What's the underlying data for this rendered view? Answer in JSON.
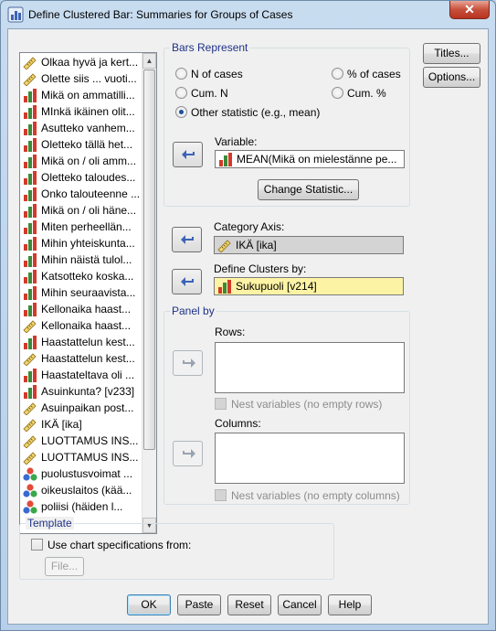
{
  "window": {
    "title": "Define Clustered Bar: Summaries for Groups of Cases",
    "close_glyph": "✕"
  },
  "variables": [
    {
      "label": "Olkaa hyvä ja kert...",
      "icon": "scale-ruler-icon"
    },
    {
      "label": "Olette siis ... vuoti...",
      "icon": "scale-ruler-icon"
    },
    {
      "label": "Mikä on ammatilli...",
      "icon": "bar-chart-icon"
    },
    {
      "label": "MInkä ikäinen olit...",
      "icon": "bar-chart-icon"
    },
    {
      "label": "Asutteko vanhem...",
      "icon": "bar-chart-icon"
    },
    {
      "label": "Oletteko tällä het...",
      "icon": "bar-chart-icon"
    },
    {
      "label": "Mikä on / oli amm...",
      "icon": "bar-chart-icon"
    },
    {
      "label": "Oletteko taloudes...",
      "icon": "bar-chart-icon"
    },
    {
      "label": "Onko talouteenne ...",
      "icon": "bar-chart-icon"
    },
    {
      "label": "Mikä on / oli häne...",
      "icon": "bar-chart-icon"
    },
    {
      "label": "Miten perheellän...",
      "icon": "bar-chart-icon"
    },
    {
      "label": "Mihin yhteiskunta...",
      "icon": "bar-chart-icon"
    },
    {
      "label": "Mihin näistä tulol...",
      "icon": "bar-chart-icon"
    },
    {
      "label": "Katsotteko koska...",
      "icon": "bar-chart-icon"
    },
    {
      "label": "Mihin seuraavista...",
      "icon": "bar-chart-icon"
    },
    {
      "label": "Kellonaika haast...",
      "icon": "bar-chart-icon"
    },
    {
      "label": "Kellonaika haast...",
      "icon": "scale-ruler-icon"
    },
    {
      "label": "Haastattelun kest...",
      "icon": "bar-chart-icon"
    },
    {
      "label": "Haastattelun kest...",
      "icon": "scale-ruler-icon"
    },
    {
      "label": "Haastateltava oli ...",
      "icon": "bar-chart-icon"
    },
    {
      "label": "Asuinkunta? [v233]",
      "icon": "bar-chart-icon"
    },
    {
      "label": "Asuinpaikan post...",
      "icon": "scale-ruler-icon"
    },
    {
      "label": "IKÄ [ika]",
      "icon": "scale-ruler-icon"
    },
    {
      "label": "LUOTTAMUS INS...",
      "icon": "scale-ruler-icon"
    },
    {
      "label": "LUOTTAMUS INS...",
      "icon": "scale-ruler-icon"
    },
    {
      "label": "puolustusvoimat ...",
      "icon": "nominal-circles-icon"
    },
    {
      "label": "oikeuslaitos (kää...",
      "icon": "nominal-circles-icon"
    },
    {
      "label": "poliisi (häiden l...",
      "icon": "nominal-circles-icon"
    }
  ],
  "bars_represent": {
    "title": "Bars Represent",
    "n_of_cases": "N of cases",
    "pct_of_cases": "% of cases",
    "cum_n": "Cum. N",
    "cum_pct": "Cum. %",
    "other_statistic": "Other statistic (e.g., mean)",
    "selected": "other_statistic",
    "variable_label": "Variable:",
    "variable_value": "MEAN(Mikä on mielestänne pe...",
    "change_statistic": "Change Statistic..."
  },
  "category_axis": {
    "label": "Category Axis:",
    "value": "IKÄ [ika]"
  },
  "define_clusters": {
    "label": "Define Clusters by:",
    "value": "Sukupuoli [v214]"
  },
  "panel_by": {
    "title": "Panel by",
    "rows_label": "Rows:",
    "nest_rows": "Nest variables (no empty rows)",
    "columns_label": "Columns:",
    "nest_columns": "Nest variables (no empty columns)"
  },
  "template": {
    "title": "Template",
    "use_chart_specs": "Use chart specifications from:",
    "file_button": "File..."
  },
  "side_buttons": {
    "titles": "Titles...",
    "options": "Options..."
  },
  "footer_buttons": {
    "ok": "OK",
    "paste": "Paste",
    "reset": "Reset",
    "cancel": "Cancel",
    "help": "Help"
  },
  "colors": {
    "group_title": "#1e3287",
    "clusters_field": "#fdf3a5",
    "category_field": "#d4d4d4",
    "arrow_blue": "#3b63b6"
  }
}
